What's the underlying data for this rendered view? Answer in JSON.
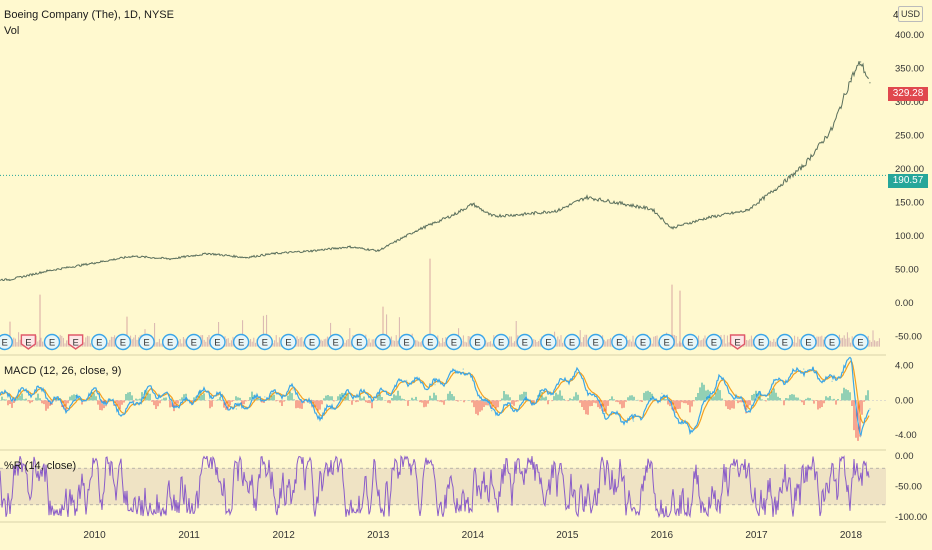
{
  "header": {
    "symbol_line": "Boeing Company (The), 1D, NYSE",
    "vol_label": "Vol",
    "macd_label": "MACD (12, 26, close, 9)",
    "willr_label": "%R (14, close)",
    "currency": "USD",
    "top_tick_partial": "4"
  },
  "colors": {
    "background": "#fff9cf",
    "price_line": "#5a6f5c",
    "current_price_tag": "#e0484e",
    "ref_price_tag": "#26a69a",
    "macd_line": "#3aa6e8",
    "signal_line": "#f4a020",
    "hist_up": "#26a69a",
    "hist_down": "#ef5350",
    "willr_line": "#8a5cc8",
    "earnings_blue": "#3aa6e8",
    "earnings_red": "#e05a6a"
  },
  "price_tags": {
    "current": "329.28",
    "reference": "190.57"
  },
  "chart_data": [
    {
      "type": "line",
      "name": "price",
      "x": [
        2009.1,
        2009.5,
        2010.0,
        2010.4,
        2010.8,
        2011.2,
        2011.6,
        2011.9,
        2012.3,
        2012.7,
        2013.0,
        2013.4,
        2013.8,
        2014.0,
        2014.2,
        2014.5,
        2014.9,
        2015.2,
        2015.6,
        2015.9,
        2016.1,
        2016.5,
        2016.9,
        2017.2,
        2017.5,
        2017.8,
        2018.0,
        2018.1,
        2018.2
      ],
      "y": [
        35,
        48,
        60,
        70,
        66,
        74,
        68,
        74,
        78,
        84,
        78,
        108,
        132,
        148,
        130,
        132,
        138,
        158,
        148,
        140,
        112,
        128,
        138,
        170,
        205,
        260,
        335,
        360,
        329
      ],
      "ylim": [
        -70,
        430
      ],
      "yticks": [
        "400.00",
        "350.00",
        "300.00",
        "250.00",
        "200.00",
        "150.00",
        "100.00",
        "50.00",
        "0.00",
        "-50.00"
      ],
      "ref_line": 190.57
    },
    {
      "type": "line",
      "name": "MACD (12, 26, close, 9)",
      "x": [
        2009.1,
        2009.4,
        2009.7,
        2010.0,
        2010.3,
        2010.6,
        2010.9,
        2011.2,
        2011.5,
        2011.8,
        2012.1,
        2012.4,
        2012.7,
        2013.0,
        2013.3,
        2013.6,
        2013.9,
        2014.2,
        2014.5,
        2014.8,
        2015.1,
        2015.4,
        2015.7,
        2016.0,
        2016.3,
        2016.6,
        2016.9,
        2017.2,
        2017.5,
        2017.8,
        2018.0,
        2018.1,
        2018.2
      ],
      "y": [
        0.5,
        1.2,
        -0.8,
        1.0,
        -1.5,
        1.3,
        -0.6,
        1.1,
        -1.0,
        0.4,
        1.2,
        -1.8,
        0.9,
        0.5,
        2.3,
        1.8,
        3.6,
        -1.2,
        -0.6,
        1.0,
        3.2,
        -1.5,
        -2.4,
        0.8,
        -3.8,
        2.6,
        -1.0,
        2.0,
        3.6,
        2.2,
        4.6,
        -4.2,
        -1.0
      ],
      "ylim": [
        -5.5,
        5
      ],
      "yticks": [
        "4.00",
        "0.00",
        "-4.00"
      ]
    },
    {
      "type": "line",
      "name": "%R (14, close)",
      "x_range": [
        2009.1,
        2018.2
      ],
      "ylim": [
        -105,
        5
      ],
      "yticks": [
        "0.00",
        "-50.00",
        "-100.00"
      ],
      "bands": [
        -20,
        -80
      ]
    }
  ],
  "xaxis": {
    "range": [
      2009.0,
      2018.37
    ],
    "labels": [
      {
        "label": "2010",
        "x": 2010.0
      },
      {
        "label": "2011",
        "x": 2011.0
      },
      {
        "label": "2012",
        "x": 2012.0
      },
      {
        "label": "2013",
        "x": 2013.0
      },
      {
        "label": "2014",
        "x": 2014.0
      },
      {
        "label": "2015",
        "x": 2015.0
      },
      {
        "label": "2016",
        "x": 2016.0
      },
      {
        "label": "2017",
        "x": 2017.0
      },
      {
        "label": "2018",
        "x": 2018.0
      }
    ]
  },
  "earnings": {
    "glyph": "E",
    "events": [
      {
        "x": 2009.05,
        "type": "blue"
      },
      {
        "x": 2009.3,
        "type": "red"
      },
      {
        "x": 2009.55,
        "type": "blue"
      },
      {
        "x": 2009.8,
        "type": "red"
      },
      {
        "x": 2010.05,
        "type": "blue"
      },
      {
        "x": 2010.3,
        "type": "blue"
      },
      {
        "x": 2010.55,
        "type": "blue"
      },
      {
        "x": 2010.8,
        "type": "blue"
      },
      {
        "x": 2011.05,
        "type": "blue"
      },
      {
        "x": 2011.3,
        "type": "blue"
      },
      {
        "x": 2011.55,
        "type": "blue"
      },
      {
        "x": 2011.8,
        "type": "blue"
      },
      {
        "x": 2012.05,
        "type": "blue"
      },
      {
        "x": 2012.3,
        "type": "blue"
      },
      {
        "x": 2012.55,
        "type": "blue"
      },
      {
        "x": 2012.8,
        "type": "blue"
      },
      {
        "x": 2013.05,
        "type": "blue"
      },
      {
        "x": 2013.3,
        "type": "blue"
      },
      {
        "x": 2013.55,
        "type": "blue"
      },
      {
        "x": 2013.8,
        "type": "blue"
      },
      {
        "x": 2014.05,
        "type": "blue"
      },
      {
        "x": 2014.3,
        "type": "blue"
      },
      {
        "x": 2014.55,
        "type": "blue"
      },
      {
        "x": 2014.8,
        "type": "blue"
      },
      {
        "x": 2015.05,
        "type": "blue"
      },
      {
        "x": 2015.3,
        "type": "blue"
      },
      {
        "x": 2015.55,
        "type": "blue"
      },
      {
        "x": 2015.8,
        "type": "blue"
      },
      {
        "x": 2016.05,
        "type": "blue"
      },
      {
        "x": 2016.3,
        "type": "blue"
      },
      {
        "x": 2016.55,
        "type": "blue"
      },
      {
        "x": 2016.8,
        "type": "red"
      },
      {
        "x": 2017.05,
        "type": "blue"
      },
      {
        "x": 2017.3,
        "type": "blue"
      },
      {
        "x": 2017.55,
        "type": "blue"
      },
      {
        "x": 2017.8,
        "type": "blue"
      },
      {
        "x": 2018.1,
        "type": "blue"
      }
    ]
  }
}
